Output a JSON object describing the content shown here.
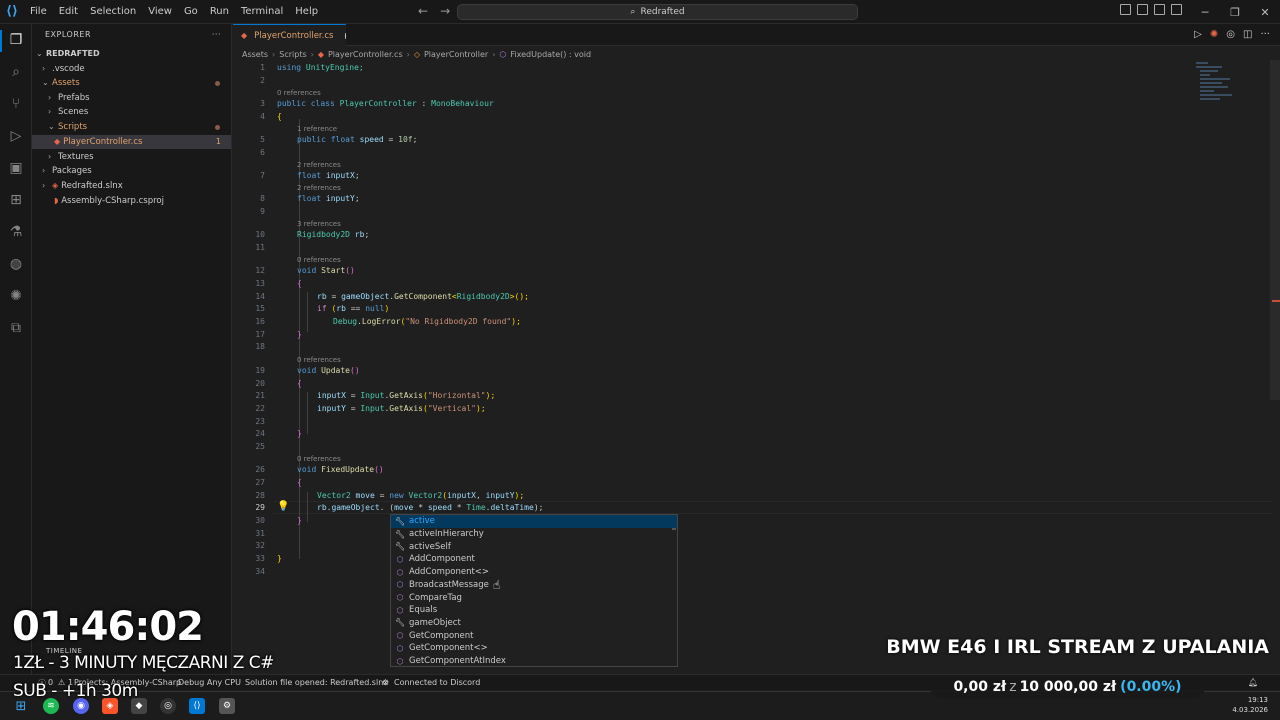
{
  "menu": [
    "File",
    "Edit",
    "Selection",
    "View",
    "Go",
    "Run",
    "Terminal",
    "Help"
  ],
  "search_text": "Redrafted",
  "explorer": {
    "title": "EXPLORER",
    "root": "REDRAFTED",
    "items": [
      ".vscode",
      "Assets",
      "Prefabs",
      "Scenes",
      "Scripts",
      "PlayerController.cs",
      "Textures",
      "Packages",
      "Redrafted.slnx",
      "Assembly-CSharp.csproj"
    ],
    "badge": "1"
  },
  "tab": {
    "label": "PlayerController.cs"
  },
  "breadcrumb": [
    "Assets",
    "Scripts",
    "PlayerController.cs",
    "PlayerController",
    "FixedUpdate() : void"
  ],
  "lens": {
    "l3": "0 references",
    "l5": "1 reference",
    "l7": "2 references",
    "l8": "2 references",
    "l10": "3 references",
    "l12": "0 references",
    "l19": "0 references",
    "l26": "0 references"
  },
  "code": {
    "l1a": "using",
    "l1b": " UnityEngine;",
    "l3a": "public class ",
    "l3b": "PlayerController",
    "l3c": " : ",
    "l3d": "MonoBehaviour",
    "l4": "{",
    "l5a": "public float ",
    "l5b": "speed",
    "l5c": " = ",
    "l5d": "10f",
    "l5e": ";",
    "l7a": "float ",
    "l7b": "inputX",
    "l7c": ";",
    "l8a": "float ",
    "l8b": "inputY",
    "l8c": ";",
    "l10a": "Rigidbody2D ",
    "l10b": "rb",
    "l10c": ";",
    "l12a": "void ",
    "l12b": "Start",
    "l12c": "()",
    "l13": "{",
    "l14a": "rb",
    "l14b": " = ",
    "l14c": "gameObject",
    "l14d": ".",
    "l14e": "GetComponent",
    "l14f": "<",
    "l14g": "Rigidbody2D",
    "l14h": ">();",
    "l15a": "if ",
    "l15b": "(",
    "l15c": "rb",
    "l15d": " == ",
    "l15e": "null",
    "l15f": ")",
    "l16a": "Debug",
    "l16b": ".",
    "l16c": "LogError",
    "l16d": "(",
    "l16e": "\"No Rigidbody2D found\"",
    "l16f": ");",
    "l17": "}",
    "l19a": "void ",
    "l19b": "Update",
    "l19c": "()",
    "l20": "{",
    "l21a": "inputX",
    "l21b": " = ",
    "l21c": "Input",
    "l21d": ".",
    "l21e": "GetAxis",
    "l21f": "(",
    "l21g": "\"Horizontal\"",
    "l21h": ");",
    "l22a": "inputY",
    "l22b": " = ",
    "l22c": "Input",
    "l22d": ".",
    "l22e": "GetAxis",
    "l22f": "(",
    "l22g": "\"Vertical\"",
    "l22h": ");",
    "l24": "}",
    "l26a": "void ",
    "l26b": "FixedUpdate",
    "l26c": "()",
    "l27": "{",
    "l28a": "Vector2 ",
    "l28b": "move",
    "l28c": " = ",
    "l28d": "new ",
    "l28e": "Vector2",
    "l28f": "(",
    "l28g": "inputX",
    "l28h": ", ",
    "l28i": "inputY",
    "l28j": ");",
    "l29a": "rb",
    "l29b": ".",
    "l29c": "gameObject",
    "l29d": ".",
    "l29e": " (",
    "l29f": "move",
    "l29g": " * ",
    "l29h": "speed",
    "l29i": " * ",
    "l29j": "Time",
    "l29k": ".",
    "l29l": "deltaTime",
    "l29m": ");",
    "l30": "}",
    "l33": "}"
  },
  "line_numbers": [
    "1",
    "2",
    "3",
    "4",
    "5",
    "6",
    "7",
    "8",
    "9",
    "10",
    "11",
    "12",
    "13",
    "14",
    "15",
    "16",
    "17",
    "18",
    "19",
    "20",
    "21",
    "22",
    "23",
    "24",
    "25",
    "26",
    "27",
    "28",
    "29",
    "30",
    "31",
    "32",
    "33",
    "34"
  ],
  "suggestions": [
    {
      "label": "active",
      "icon": "wrench-icon"
    },
    {
      "label": "activeInHierarchy",
      "icon": "wrench-icon"
    },
    {
      "label": "activeSelf",
      "icon": "wrench-icon"
    },
    {
      "label": "AddComponent",
      "icon": "method-icon"
    },
    {
      "label": "AddComponent<>",
      "icon": "method-icon"
    },
    {
      "label": "BroadcastMessage",
      "icon": "method-icon"
    },
    {
      "label": "CompareTag",
      "icon": "method-icon"
    },
    {
      "label": "Equals",
      "icon": "method-icon"
    },
    {
      "label": "gameObject",
      "icon": "wrench-icon"
    },
    {
      "label": "GetComponent",
      "icon": "method-icon"
    },
    {
      "label": "GetComponent<>",
      "icon": "method-icon"
    },
    {
      "label": "GetComponentAtIndex",
      "icon": "method-icon"
    }
  ],
  "status": {
    "errors": "0",
    "warnings": "1",
    "projects": "Projects: Assembly-CSharp",
    "debug": "Debug Any CPU",
    "solution": "Solution file opened: Redrafted.slnx",
    "discord": "Connected to Discord"
  },
  "overlay": {
    "timer": "01:46:02",
    "line1": "1ZŁ - 3 MINUTY MĘCZARNI Z C#",
    "line2": "SUB - +1h 30m",
    "title": "BMW E46 I IRL STREAM Z UPALANIA",
    "donate_current": "0,00 zł",
    "donate_sep": "z",
    "donate_goal": "10 000,00 zł",
    "donate_pct": "(0.00%)",
    "timeline": "TIMELINE"
  },
  "tray": {
    "time": "19:13",
    "date": "4.03.2026"
  },
  "colors": {
    "accent": "#0078d4",
    "modified": "#e2a26d",
    "selection": "#04395e"
  }
}
